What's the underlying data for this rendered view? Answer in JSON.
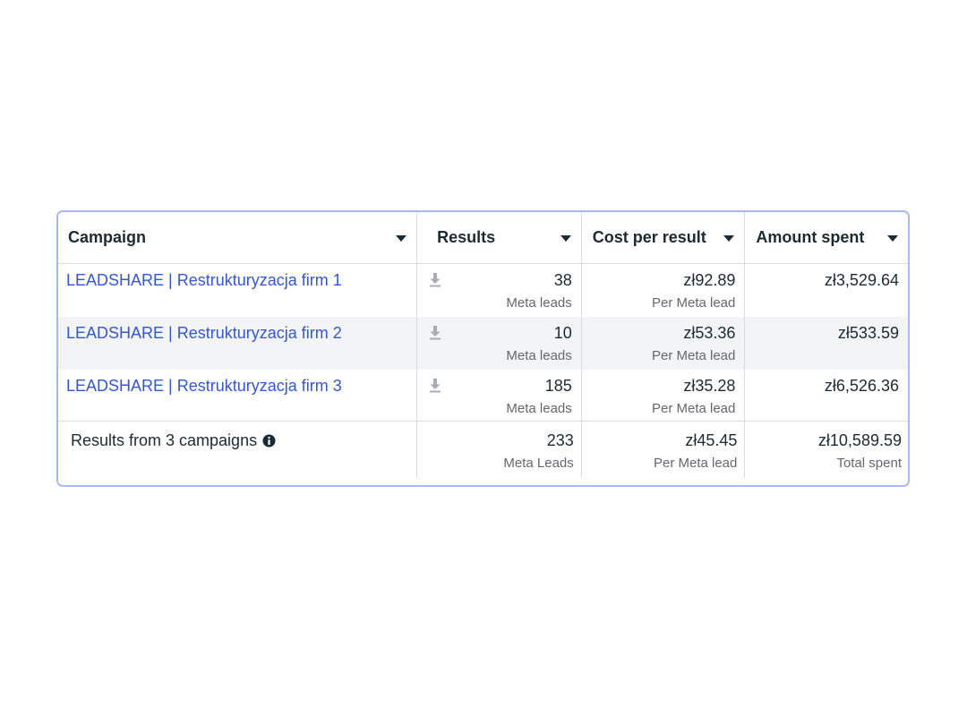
{
  "table": {
    "headers": {
      "campaign": "Campaign",
      "results": "Results",
      "cost_per_result": "Cost per result",
      "amount_spent": "Amount spent"
    },
    "rows": [
      {
        "campaign": "LEADSHARE | Restrukturyzacja firm 1",
        "results": "38",
        "results_label": "Meta leads",
        "cost": "zł92.89",
        "cost_label": "Per Meta lead",
        "spent": "zł3,529.64"
      },
      {
        "campaign": "LEADSHARE | Restrukturyzacja firm 2",
        "results": "10",
        "results_label": "Meta leads",
        "cost": "zł53.36",
        "cost_label": "Per Meta lead",
        "spent": "zł533.59"
      },
      {
        "campaign": "LEADSHARE | Restrukturyzacja firm 3",
        "results": "185",
        "results_label": "Meta leads",
        "cost": "zł35.28",
        "cost_label": "Per Meta lead",
        "spent": "zł6,526.36"
      }
    ],
    "footer": {
      "label": "Results from 3 campaigns",
      "results": "233",
      "results_label": "Meta Leads",
      "cost": "zł45.45",
      "cost_label": "Per Meta lead",
      "spent": "zł10,589.59",
      "spent_label": "Total spent"
    }
  },
  "icons": {
    "sort": "caret-down-icon",
    "download": "download-icon",
    "info": "info-icon"
  },
  "colors": {
    "link": "#3457cf",
    "border": "#aab8f5",
    "stripe": "#f3f4f6"
  }
}
